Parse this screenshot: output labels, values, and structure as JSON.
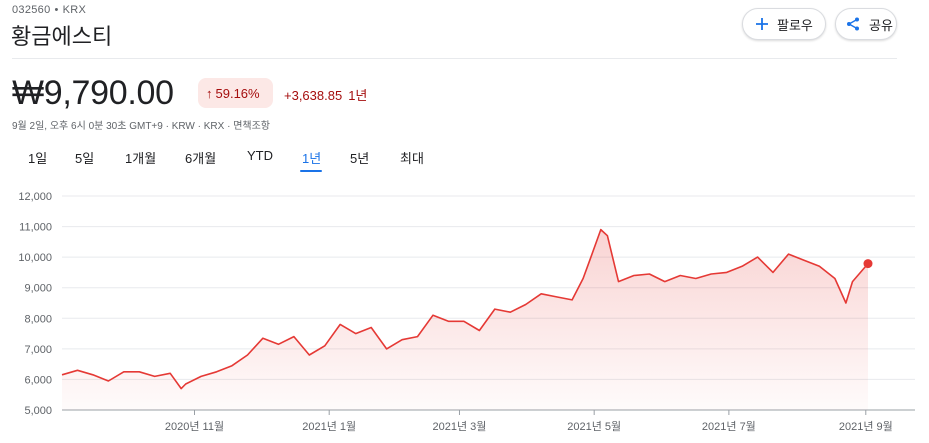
{
  "header": {
    "ticker_code": "032560",
    "exchange": "KRX",
    "company_name": "황금에스티",
    "follow_label": "팔로우",
    "share_label": "공유"
  },
  "quote": {
    "price": "₩9,790.00",
    "percent_change": "59.16%",
    "abs_change": "+3,638.85",
    "period": "1년",
    "meta": "9월 2일, 오후 6시 0분 30초 GMT+9 · KRW · KRX · 면책조항",
    "negative_color": "#a50e0e"
  },
  "tabs": [
    "1일",
    "5일",
    "1개월",
    "6개월",
    "YTD",
    "1년",
    "5년",
    "최대"
  ],
  "active_tab": "1년",
  "chart_data": {
    "type": "line",
    "title": "",
    "xlabel": "",
    "ylabel": "",
    "ylim": [
      5000,
      12000
    ],
    "yticks": [
      "5,000",
      "6,000",
      "7,000",
      "8,000",
      "9,000",
      "10,000",
      "11,000",
      "12,000"
    ],
    "xticks": [
      "2020년 11월",
      "2021년 1월",
      "2021년 3월",
      "2021년 5월",
      "2021년 7월",
      "2021년 9월"
    ],
    "grid": true,
    "line_color": "#e53935",
    "series": [
      {
        "x": [
          "2020-09-02",
          "2020-09-09",
          "2020-09-16",
          "2020-09-23",
          "2020-09-30",
          "2020-10-07",
          "2020-10-14",
          "2020-10-21",
          "2020-10-26",
          "2020-10-28",
          "2020-11-04",
          "2020-11-11",
          "2020-11-18",
          "2020-11-25",
          "2020-12-02",
          "2020-12-09",
          "2020-12-16",
          "2020-12-23",
          "2020-12-30",
          "2021-01-06",
          "2021-01-13",
          "2021-01-20",
          "2021-01-27",
          "2021-02-03",
          "2021-02-10",
          "2021-02-17",
          "2021-02-24",
          "2021-03-03",
          "2021-03-10",
          "2021-03-17",
          "2021-03-24",
          "2021-03-31",
          "2021-04-07",
          "2021-04-14",
          "2021-04-21",
          "2021-04-26",
          "2021-04-29",
          "2021-05-04",
          "2021-05-07",
          "2021-05-12",
          "2021-05-19",
          "2021-05-26",
          "2021-06-02",
          "2021-06-09",
          "2021-06-16",
          "2021-06-23",
          "2021-06-30",
          "2021-07-07",
          "2021-07-14",
          "2021-07-21",
          "2021-07-28",
          "2021-08-04",
          "2021-08-11",
          "2021-08-18",
          "2021-08-23",
          "2021-08-26",
          "2021-09-02"
        ],
        "values": [
          6150,
          6300,
          6150,
          5950,
          6250,
          6250,
          6100,
          6200,
          5700,
          5850,
          6100,
          6250,
          6450,
          6800,
          7350,
          7150,
          7400,
          6800,
          7100,
          7800,
          7500,
          7700,
          7000,
          7300,
          7400,
          8100,
          7900,
          7900,
          7600,
          8300,
          8200,
          8450,
          8800,
          8700,
          8600,
          9300,
          9900,
          10900,
          10700,
          9200,
          9400,
          9450,
          9200,
          9400,
          9300,
          9450,
          9500,
          9700,
          10000,
          9500,
          10100,
          9900,
          9700,
          9300,
          8500,
          9200,
          9790
        ]
      }
    ]
  }
}
